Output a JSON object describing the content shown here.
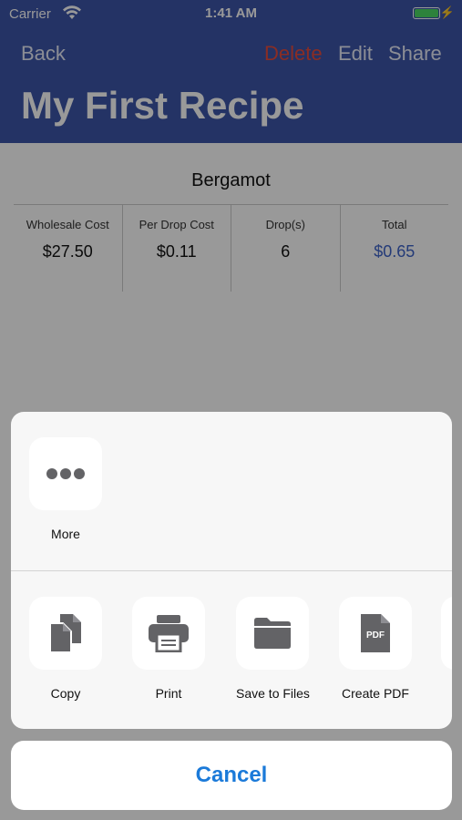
{
  "status_bar": {
    "carrier": "Carrier",
    "time": "1:41 AM"
  },
  "nav": {
    "back_label": "Back",
    "delete_label": "Delete",
    "edit_label": "Edit",
    "share_label": "Share",
    "title": "My First Recipe"
  },
  "ingredient": {
    "name": "Bergamot",
    "columns": [
      {
        "label": "Wholesale Cost",
        "value": "$27.50"
      },
      {
        "label": "Per Drop Cost",
        "value": "$0.11"
      },
      {
        "label": "Drop(s)",
        "value": "6"
      },
      {
        "label": "Total",
        "value": "$0.65"
      }
    ]
  },
  "share_sheet": {
    "row1": [
      {
        "label": "More",
        "icon": "more-icon"
      }
    ],
    "row2": [
      {
        "label": "Copy",
        "icon": "copy-icon"
      },
      {
        "label": "Print",
        "icon": "printer-icon"
      },
      {
        "label": "Save to Files",
        "icon": "folder-icon"
      },
      {
        "label": "Create PDF",
        "icon": "pdf-icon"
      }
    ],
    "cancel_label": "Cancel"
  },
  "colors": {
    "nav_bar": "#3d55a8",
    "delete": "#e74c3c",
    "total": "#3d63c9",
    "cancel": "#1b7ad9",
    "battery": "#4cd964"
  }
}
